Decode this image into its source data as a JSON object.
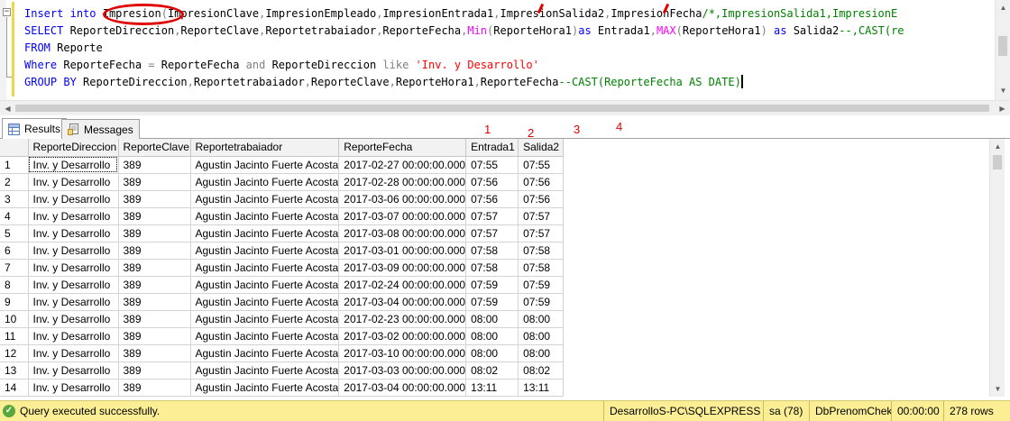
{
  "editor": {
    "collapse_glyph": "−",
    "lines": [
      [
        {
          "t": "Insert",
          "c": "kw"
        },
        {
          "t": " ",
          "c": ""
        },
        {
          "t": "into",
          "c": "kw"
        },
        {
          "t": " Impresion",
          "c": ""
        },
        {
          "t": "(",
          "c": "gr"
        },
        {
          "t": "ImpresionClave",
          "c": ""
        },
        {
          "t": ",",
          "c": "gr"
        },
        {
          "t": "ImpresionEmpleado",
          "c": ""
        },
        {
          "t": ",",
          "c": "gr"
        },
        {
          "t": "ImpresionEntrada1",
          "c": ""
        },
        {
          "t": ",",
          "c": "gr"
        },
        {
          "t": "ImpresionSalida2",
          "c": ""
        },
        {
          "t": ",",
          "c": "gr"
        },
        {
          "t": "ImpresionFecha",
          "c": ""
        },
        {
          "t": "/*,ImpresionSalida1,ImpresionE",
          "c": "cm"
        }
      ],
      [
        {
          "t": "SELECT",
          "c": "kw"
        },
        {
          "t": " ReporteDireccion",
          "c": ""
        },
        {
          "t": ",",
          "c": "gr"
        },
        {
          "t": "ReporteClave",
          "c": ""
        },
        {
          "t": ",",
          "c": "gr"
        },
        {
          "t": "Reportetrabaiador",
          "c": ""
        },
        {
          "t": ",",
          "c": "gr"
        },
        {
          "t": "ReporteFecha",
          "c": ""
        },
        {
          "t": ",",
          "c": "gr"
        },
        {
          "t": "Min",
          "c": "fn"
        },
        {
          "t": "(",
          "c": "gr"
        },
        {
          "t": "ReporteHora1",
          "c": ""
        },
        {
          "t": ")",
          "c": "gr"
        },
        {
          "t": "as",
          "c": "kw"
        },
        {
          "t": " Entrada1",
          "c": ""
        },
        {
          "t": ",",
          "c": "gr"
        },
        {
          "t": "MAX",
          "c": "fn"
        },
        {
          "t": "(",
          "c": "gr"
        },
        {
          "t": "ReporteHora1",
          "c": ""
        },
        {
          "t": ")",
          "c": "gr"
        },
        {
          "t": " as",
          "c": "kw"
        },
        {
          "t": " Salida2",
          "c": ""
        },
        {
          "t": "--,CAST(re",
          "c": "cm"
        }
      ],
      [
        {
          "t": "FROM",
          "c": "kw"
        },
        {
          "t": " Reporte",
          "c": ""
        }
      ],
      [
        {
          "t": "Where",
          "c": "kw"
        },
        {
          "t": " ReporteFecha ",
          "c": ""
        },
        {
          "t": "=",
          "c": "gr"
        },
        {
          "t": " ReporteFecha ",
          "c": ""
        },
        {
          "t": "and",
          "c": "gr"
        },
        {
          "t": " ReporteDireccion ",
          "c": ""
        },
        {
          "t": "like",
          "c": "gr"
        },
        {
          "t": " ",
          "c": ""
        },
        {
          "t": "'Inv. y Desarrollo'",
          "c": "st"
        }
      ],
      [
        {
          "t": "GROUP BY",
          "c": "kw"
        },
        {
          "t": " ReporteDireccion",
          "c": ""
        },
        {
          "t": ",",
          "c": "gr"
        },
        {
          "t": "Reportetrabaiador",
          "c": ""
        },
        {
          "t": ",",
          "c": "gr"
        },
        {
          "t": "ReporteClave",
          "c": ""
        },
        {
          "t": ",",
          "c": "gr"
        },
        {
          "t": "ReporteHora1",
          "c": ""
        },
        {
          "t": ",",
          "c": "gr"
        },
        {
          "t": "ReporteFecha",
          "c": ""
        },
        {
          "t": "--CAST(ReporteFecha AS DATE)",
          "c": "cm"
        }
      ]
    ]
  },
  "tabs": {
    "results_label": "Results",
    "messages_label": "Messages"
  },
  "annotations": {
    "numbers": [
      "1",
      "2",
      "3",
      "4"
    ]
  },
  "grid": {
    "columns": [
      "ReporteDireccion",
      "ReporteClave",
      "Reportetrabaiador",
      "ReporteFecha",
      "Entrada1",
      "Salida2"
    ],
    "rows": [
      [
        "1",
        "Inv. y Desarrollo",
        "389",
        "Agustin Jacinto Fuerte Acosta",
        "2017-02-27 00:00:00.000",
        "07:55",
        "07:55"
      ],
      [
        "2",
        "Inv. y Desarrollo",
        "389",
        "Agustin Jacinto Fuerte Acosta",
        "2017-02-28 00:00:00.000",
        "07:56",
        "07:56"
      ],
      [
        "3",
        "Inv. y Desarrollo",
        "389",
        "Agustin Jacinto Fuerte Acosta",
        "2017-03-06 00:00:00.000",
        "07:56",
        "07:56"
      ],
      [
        "4",
        "Inv. y Desarrollo",
        "389",
        "Agustin Jacinto Fuerte Acosta",
        "2017-03-07 00:00:00.000",
        "07:57",
        "07:57"
      ],
      [
        "5",
        "Inv. y Desarrollo",
        "389",
        "Agustin Jacinto Fuerte Acosta",
        "2017-03-08 00:00:00.000",
        "07:57",
        "07:57"
      ],
      [
        "6",
        "Inv. y Desarrollo",
        "389",
        "Agustin Jacinto Fuerte Acosta",
        "2017-03-01 00:00:00.000",
        "07:58",
        "07:58"
      ],
      [
        "7",
        "Inv. y Desarrollo",
        "389",
        "Agustin Jacinto Fuerte Acosta",
        "2017-03-09 00:00:00.000",
        "07:58",
        "07:58"
      ],
      [
        "8",
        "Inv. y Desarrollo",
        "389",
        "Agustin Jacinto Fuerte Acosta",
        "2017-02-24 00:00:00.000",
        "07:59",
        "07:59"
      ],
      [
        "9",
        "Inv. y Desarrollo",
        "389",
        "Agustin Jacinto Fuerte Acosta",
        "2017-03-04 00:00:00.000",
        "07:59",
        "07:59"
      ],
      [
        "10",
        "Inv. y Desarrollo",
        "389",
        "Agustin Jacinto Fuerte Acosta",
        "2017-02-23 00:00:00.000",
        "08:00",
        "08:00"
      ],
      [
        "11",
        "Inv. y Desarrollo",
        "389",
        "Agustin Jacinto Fuerte Acosta",
        "2017-03-02 00:00:00.000",
        "08:00",
        "08:00"
      ],
      [
        "12",
        "Inv. y Desarrollo",
        "389",
        "Agustin Jacinto Fuerte Acosta",
        "2017-03-10 00:00:00.000",
        "08:00",
        "08:00"
      ],
      [
        "13",
        "Inv. y Desarrollo",
        "389",
        "Agustin Jacinto Fuerte Acosta",
        "2017-03-03 00:00:00.000",
        "08:02",
        "08:02"
      ],
      [
        "14",
        "Inv. y Desarrollo",
        "389",
        "Agustin Jacinto Fuerte Acosta",
        "2017-03-04 00:00:00.000",
        "13:11",
        "13:11"
      ]
    ]
  },
  "status": {
    "icon": "check-circle-icon",
    "message": "Query executed successfully.",
    "server": "DesarrolloS-PC\\SQLEXPRESS (...",
    "user": "sa (78)",
    "database": "DbPrenomChek",
    "elapsed": "00:00:00",
    "rows": "278 rows"
  }
}
